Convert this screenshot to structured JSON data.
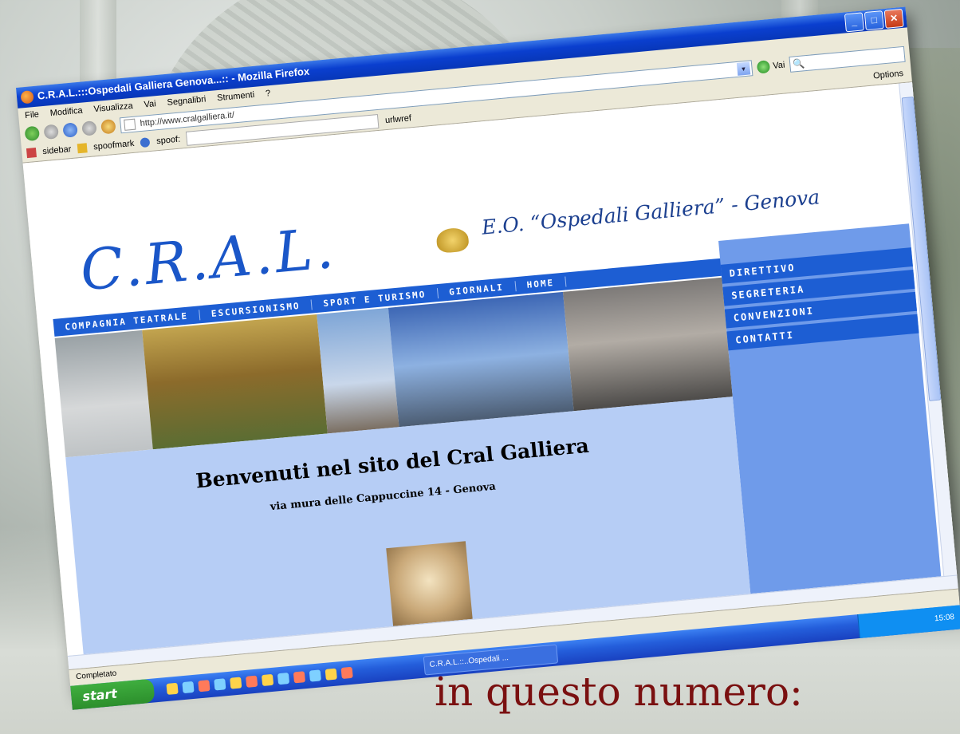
{
  "browser": {
    "window_title": "C.R.A.L.:::Ospedali Galliera Genova...:: - Mozilla Firefox",
    "menu": [
      "File",
      "Modifica",
      "Visualizza",
      "Vai",
      "Segnalibri",
      "Strumenti",
      "?"
    ],
    "url": "http://www.cralgalliera.it/",
    "go_label": "Vai",
    "bookmarks": [
      "sidebar",
      "spoofmark",
      "spoof:"
    ],
    "url_right": "urlwref",
    "options_label": "Options",
    "status": "Completato"
  },
  "site": {
    "logo": "C.R.A.L.",
    "organization": "E.O. “Ospedali Galliera” - Genova",
    "top_menu": [
      "COMPAGNIA TEATRALE",
      "ESCURSIONISMO",
      "SPORT E TURISMO",
      "GIORNALI",
      "HOME"
    ],
    "side_menu": [
      "DIRETTIVO",
      "SEGRETERIA",
      "CONVENZIONI",
      "CONTATTI"
    ],
    "welcome": "Benvenuti nel sito del Cral Galliera",
    "address": "via mura delle Cappuccine 14 - Genova"
  },
  "taskbar": {
    "start_label": "start",
    "task_label": "C.R.A.L.::..Ospedali ...",
    "clock": "15:08"
  },
  "caption": "in questo numero:"
}
